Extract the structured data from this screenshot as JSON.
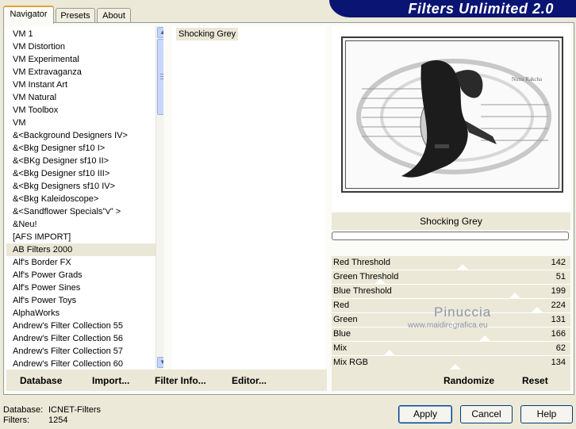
{
  "window": {
    "title": "Filters Unlimited 2.0"
  },
  "tabs": [
    {
      "label": "Navigator"
    },
    {
      "label": "Presets"
    },
    {
      "label": "About"
    }
  ],
  "filter_list": [
    "VM 1",
    "VM Distortion",
    "VM Experimental",
    "VM Extravaganza",
    "VM Instant Art",
    "VM Natural",
    "VM Toolbox",
    "VM",
    "&<Background Designers IV>",
    "&<Bkg Designer sf10 I>",
    "&<BKg Designer sf10 II>",
    "&<Bkg Designer sf10 III>",
    "&<Bkg Designers sf10 IV>",
    "&<Bkg Kaleidoscope>",
    "&<Sandflower Specials\"v\" >",
    "&Neu!",
    "[AFS IMPORT]",
    "AB Filters 2000",
    "Alf's Border FX",
    "Alf's Power Grads",
    "Alf's Power Sines",
    "Alf's Power Toys",
    "AlphaWorks",
    "Andrew's Filter Collection 55",
    "Andrew's Filter Collection 56",
    "Andrew's Filter Collection 57",
    "Andrew's Filter Collection 60"
  ],
  "selected_filter": "AB Filters 2000",
  "effect_list": [
    "Shocking Grey"
  ],
  "left_buttons": {
    "database": "Database",
    "import": "Import...",
    "filter_info": "Filter Info...",
    "editor": "Editor..."
  },
  "preview": {
    "effect_name": "Shocking Grey",
    "image_caption": "Nima Rakcha",
    "progress": 0
  },
  "params": [
    {
      "label": "Red Threshold",
      "value": "142",
      "level": 0.557
    },
    {
      "label": "Green Threshold",
      "value": "51",
      "level": 0.2
    },
    {
      "label": "Blue Threshold",
      "value": "199",
      "level": 0.78
    },
    {
      "label": "Red",
      "value": "224",
      "level": 0.878
    },
    {
      "label": "Green",
      "value": "131",
      "level": 0.514
    },
    {
      "label": "Blue",
      "value": "166",
      "level": 0.651
    },
    {
      "label": "Mix",
      "value": "62",
      "level": 0.243
    },
    {
      "label": "Mix RGB",
      "value": "134",
      "level": 0.525
    }
  ],
  "right_buttons": {
    "randomize": "Randomize",
    "reset": "Reset"
  },
  "watermark": {
    "name": "Pinuccia",
    "url": "www.maidiregrafica.eu"
  },
  "footer": {
    "database_label": "Database:",
    "database_value": "ICNET-Filters",
    "filters_label": "Filters:",
    "filters_value": "1254",
    "apply": "Apply",
    "cancel": "Cancel",
    "help": "Help"
  },
  "colors": {
    "title_bar": "#0a1473",
    "panel": "#ece9d8",
    "selection": "#ebe7d6"
  }
}
